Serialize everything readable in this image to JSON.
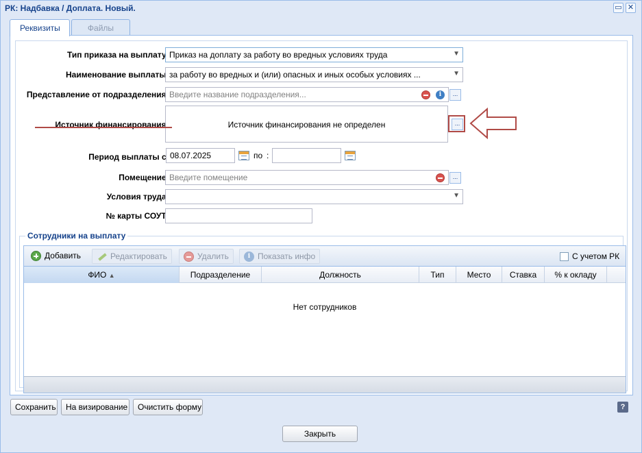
{
  "window": {
    "title": "РК: Надбавка / Доплата. Новый."
  },
  "tabs": [
    {
      "label": "Реквизиты",
      "active": true
    },
    {
      "label": "Файлы",
      "active": false
    }
  ],
  "form": {
    "order_type": {
      "label": "Тип приказа на выплату :",
      "value": "Приказ на доплату за работу во вредных условиях труда"
    },
    "payment_name": {
      "label": "Наименование выплаты :",
      "value": "за работу во вредных и (или) опасных и иных особых условиях ..."
    },
    "department": {
      "label": "Представление от подразделения :",
      "placeholder": "Введите название подразделения..."
    },
    "funding": {
      "label": "Источник финансирования :",
      "value": "Источник финансирования не определен"
    },
    "period": {
      "label": "Период выплаты с :",
      "from": "08.07.2025",
      "to_label": "по",
      "to_colon": ":",
      "to": ""
    },
    "room": {
      "label": "Помещение :",
      "placeholder": "Введите помещение"
    },
    "work_conditions": {
      "label": "Условия труда :",
      "value": ""
    },
    "sout_card": {
      "label": "№ карты СОУТ :",
      "value": ""
    }
  },
  "employees": {
    "legend": "Сотрудники на выплату",
    "toolbar": {
      "add": "Добавить",
      "edit": "Редактировать",
      "delete": "Удалить",
      "info": "Показать инфо",
      "rk_checkbox": "С учетом РК"
    },
    "columns": {
      "fio": "ФИО",
      "department": "Подразделение",
      "position": "Должность",
      "type": "Тип",
      "place": "Место",
      "rate": "Ставка",
      "percent": "% к окладу"
    },
    "empty_text": "Нет сотрудников"
  },
  "footer": {
    "save": "Сохранить",
    "approve": "На визирование",
    "clear": "Очистить форму",
    "help": "?",
    "close": "Закрыть"
  },
  "icons": {
    "dropdown": "chevron-down-icon",
    "clear": "remove-circle-icon",
    "info": "info-icon",
    "calendar": "calendar-icon",
    "annotation_arrow": "arrow-left-icon"
  },
  "colors": {
    "accent": "#15428b",
    "annotation": "#b04a46"
  }
}
